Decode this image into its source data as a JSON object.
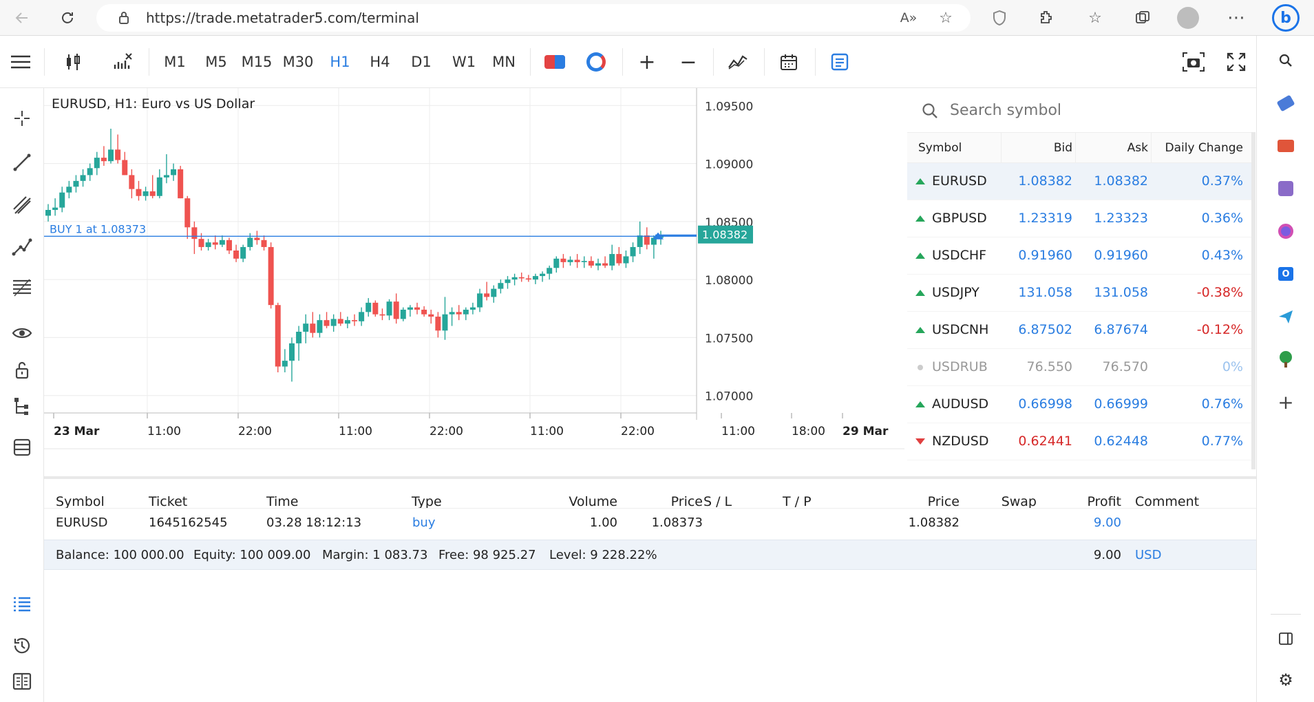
{
  "browser": {
    "url": "https://trade.metatrader5.com/terminal",
    "icons": [
      "back-icon",
      "refresh-icon",
      "lock-icon",
      "read-aloud-icon",
      "add-favorite-icon",
      "shield-icon",
      "extensions-icon",
      "favorites-icon",
      "collections-icon",
      "profile-icon",
      "more-icon",
      "bing-icon"
    ]
  },
  "edge_sidebar": {
    "icons": [
      "search-icon",
      "tag-icon",
      "toolbox-icon",
      "games-icon",
      "office-icon",
      "outlook-icon",
      "send-icon",
      "tree-icon",
      "add-icon",
      "sidebar-toggle-icon",
      "settings-icon"
    ]
  },
  "toolbar": {
    "timeframes": [
      "M1",
      "M5",
      "M15",
      "M30",
      "H1",
      "H4",
      "D1",
      "W1",
      "MN"
    ],
    "active_timeframe": "H1",
    "zoom_in": "+",
    "zoom_out": "−"
  },
  "chart": {
    "title": "EURUSD, H1: Euro vs US Dollar",
    "buy_label": "BUY 1 at 1.08373",
    "current_price_label": "1.08382",
    "accent": "#26a69a",
    "down_color": "#ef5350",
    "line_color": "#2a7de1"
  },
  "chart_data": {
    "type": "candlestick",
    "ylim": [
      1.0685,
      1.0965
    ],
    "y_ticks": [
      "1.09500",
      "1.09000",
      "1.08500",
      "1.08000",
      "1.07500",
      "1.07000"
    ],
    "y_tick_values": [
      1.095,
      1.09,
      1.085,
      1.08,
      1.075,
      1.07
    ],
    "x_tick_labels": [
      "23 Mar",
      "11:00",
      "22:00",
      "11:00",
      "22:00",
      "11:00",
      "22:00",
      "11:00",
      "18:00",
      "29 Mar"
    ],
    "buy_price": 1.08373,
    "current_price": 1.08382,
    "candles": [
      [
        1.0855,
        1.0865,
        1.085,
        1.086
      ],
      [
        1.086,
        1.087,
        1.0855,
        1.0862
      ],
      [
        1.0862,
        1.088,
        1.0858,
        1.0875
      ],
      [
        1.0875,
        1.0885,
        1.087,
        1.088
      ],
      [
        1.088,
        1.089,
        1.0875,
        1.0885
      ],
      [
        1.0885,
        1.0895,
        1.088,
        1.089
      ],
      [
        1.089,
        1.09,
        1.0885,
        1.0896
      ],
      [
        1.0896,
        1.091,
        1.089,
        1.0905
      ],
      [
        1.0905,
        1.0915,
        1.0898,
        1.0902
      ],
      [
        1.0902,
        1.093,
        1.09,
        1.0912
      ],
      [
        1.0912,
        1.0925,
        1.09,
        1.0903
      ],
      [
        1.0903,
        1.091,
        1.089,
        1.089
      ],
      [
        1.089,
        1.0895,
        1.087,
        1.0878
      ],
      [
        1.0878,
        1.0885,
        1.0868,
        1.0872
      ],
      [
        1.0872,
        1.088,
        1.0868,
        1.0876
      ],
      [
        1.0876,
        1.089,
        1.087,
        1.0872
      ],
      [
        1.0872,
        1.0895,
        1.087,
        1.0888
      ],
      [
        1.0888,
        1.0908,
        1.0883,
        1.089
      ],
      [
        1.089,
        1.09,
        1.0885,
        1.0895
      ],
      [
        1.0895,
        1.0898,
        1.087,
        1.087
      ],
      [
        1.087,
        1.0872,
        1.0835,
        1.0845
      ],
      [
        1.0845,
        1.085,
        1.0822,
        1.0835
      ],
      [
        1.0835,
        1.084,
        1.0825,
        1.0828
      ],
      [
        1.0828,
        1.0835,
        1.0825,
        1.0832
      ],
      [
        1.0832,
        1.0838,
        1.0826,
        1.083
      ],
      [
        1.083,
        1.0838,
        1.0828,
        1.0834
      ],
      [
        1.0834,
        1.0836,
        1.0822,
        1.0825
      ],
      [
        1.0825,
        1.083,
        1.0815,
        1.0818
      ],
      [
        1.0818,
        1.083,
        1.0815,
        1.0828
      ],
      [
        1.0828,
        1.084,
        1.0825,
        1.0836
      ],
      [
        1.0836,
        1.0842,
        1.083,
        1.0834
      ],
      [
        1.0834,
        1.0838,
        1.0825,
        1.0828
      ],
      [
        1.0828,
        1.0832,
        1.0775,
        1.0778
      ],
      [
        1.0778,
        1.078,
        1.072,
        1.0725
      ],
      [
        1.0725,
        1.074,
        1.072,
        1.073
      ],
      [
        1.073,
        1.075,
        1.0712,
        1.0745
      ],
      [
        1.0745,
        1.076,
        1.073,
        1.0755
      ],
      [
        1.0755,
        1.077,
        1.0745,
        1.0762
      ],
      [
        1.0762,
        1.0772,
        1.075,
        1.0754
      ],
      [
        1.0754,
        1.077,
        1.075,
        1.0765
      ],
      [
        1.0765,
        1.0772,
        1.0758,
        1.076
      ],
      [
        1.076,
        1.077,
        1.0755,
        1.0766
      ],
      [
        1.0766,
        1.0772,
        1.076,
        1.0762
      ],
      [
        1.0762,
        1.0768,
        1.0758,
        1.0765
      ],
      [
        1.0765,
        1.077,
        1.076,
        1.0764
      ],
      [
        1.0764,
        1.0776,
        1.076,
        1.0772
      ],
      [
        1.0772,
        1.0784,
        1.0768,
        1.078
      ],
      [
        1.078,
        1.0782,
        1.0768,
        1.077
      ],
      [
        1.077,
        1.0775,
        1.0765,
        1.0769
      ],
      [
        1.0769,
        1.0783,
        1.0765,
        1.0781
      ],
      [
        1.0781,
        1.0788,
        1.0762,
        1.0766
      ],
      [
        1.0766,
        1.0776,
        1.0764,
        1.0774
      ],
      [
        1.0774,
        1.0778,
        1.0768,
        1.0776
      ],
      [
        1.0776,
        1.078,
        1.077,
        1.0774
      ],
      [
        1.0774,
        1.0777,
        1.0768,
        1.077
      ],
      [
        1.077,
        1.0774,
        1.0762,
        1.0768
      ],
      [
        1.0768,
        1.0772,
        1.075,
        1.0756
      ],
      [
        1.0756,
        1.0785,
        1.0748,
        1.077
      ],
      [
        1.077,
        1.0776,
        1.076,
        1.0772
      ],
      [
        1.0772,
        1.0778,
        1.0765,
        1.077
      ],
      [
        1.077,
        1.0776,
        1.0765,
        1.0774
      ],
      [
        1.0774,
        1.078,
        1.077,
        1.0776
      ],
      [
        1.0776,
        1.0792,
        1.0772,
        1.0788
      ],
      [
        1.0788,
        1.0798,
        1.0782,
        1.0785
      ],
      [
        1.0785,
        1.0795,
        1.078,
        1.0792
      ],
      [
        1.0792,
        1.08,
        1.0788,
        1.0797
      ],
      [
        1.0797,
        1.0803,
        1.0792,
        1.08
      ],
      [
        1.08,
        1.0805,
        1.0795,
        1.0802
      ],
      [
        1.0802,
        1.0806,
        1.0798,
        1.0801
      ],
      [
        1.0801,
        1.0804,
        1.0798,
        1.08
      ],
      [
        1.08,
        1.0805,
        1.0796,
        1.0803
      ],
      [
        1.0803,
        1.0807,
        1.0798,
        1.0805
      ],
      [
        1.0805,
        1.0812,
        1.08,
        1.081
      ],
      [
        1.081,
        1.082,
        1.0806,
        1.0818
      ],
      [
        1.0818,
        1.0822,
        1.081,
        1.0815
      ],
      [
        1.0815,
        1.082,
        1.0812,
        1.0817
      ],
      [
        1.0817,
        1.0822,
        1.081,
        1.0815
      ],
      [
        1.0815,
        1.082,
        1.081,
        1.0816
      ],
      [
        1.0816,
        1.082,
        1.081,
        1.0812
      ],
      [
        1.0812,
        1.0818,
        1.0808,
        1.0814
      ],
      [
        1.0814,
        1.082,
        1.081,
        1.0812
      ],
      [
        1.0812,
        1.083,
        1.0808,
        1.0822
      ],
      [
        1.0822,
        1.0828,
        1.0812,
        1.0814
      ],
      [
        1.0814,
        1.0825,
        1.081,
        1.082
      ],
      [
        1.082,
        1.0832,
        1.0815,
        1.0828
      ],
      [
        1.0828,
        1.085,
        1.0822,
        1.0838
      ],
      [
        1.0838,
        1.0845,
        1.0826,
        1.083
      ],
      [
        1.083,
        1.0838,
        1.0818,
        1.0836
      ],
      [
        1.0836,
        1.0842,
        1.083,
        1.0838
      ]
    ]
  },
  "market_watch": {
    "search_placeholder": "Search symbol",
    "headers": {
      "symbol": "Symbol",
      "bid": "Bid",
      "ask": "Ask",
      "change": "Daily Change"
    },
    "rows": [
      {
        "symbol": "EURUSD",
        "bid": "1.08382",
        "ask": "1.08382",
        "change": "0.37%",
        "dir": "up"
      },
      {
        "symbol": "GBPUSD",
        "bid": "1.23319",
        "ask": "1.23323",
        "change": "0.36%",
        "dir": "up"
      },
      {
        "symbol": "USDCHF",
        "bid": "0.91960",
        "ask": "0.91960",
        "change": "0.43%",
        "dir": "up"
      },
      {
        "symbol": "USDJPY",
        "bid": "131.058",
        "ask": "131.058",
        "change": "-0.38%",
        "dir": "up"
      },
      {
        "symbol": "USDCNH",
        "bid": "6.87502",
        "ask": "6.87674",
        "change": "-0.12%",
        "dir": "up"
      },
      {
        "symbol": "USDRUB",
        "bid": "76.550",
        "ask": "76.570",
        "change": "0%",
        "dir": "flat"
      },
      {
        "symbol": "AUDUSD",
        "bid": "0.66998",
        "ask": "0.66999",
        "change": "0.76%",
        "dir": "up"
      },
      {
        "symbol": "NZDUSD",
        "bid": "0.62441",
        "ask": "0.62448",
        "change": "0.77%",
        "dir": "down"
      }
    ]
  },
  "trade": {
    "headers": {
      "symbol": "Symbol",
      "ticket": "Ticket",
      "time": "Time",
      "type": "Type",
      "volume": "Volume",
      "price": "Price",
      "sl": "S / L",
      "tp": "T / P",
      "price2": "Price",
      "swap": "Swap",
      "profit": "Profit",
      "comment": "Comment"
    },
    "row": {
      "symbol": "EURUSD",
      "ticket": "1645162545",
      "time": "03.28 18:12:13",
      "type": "buy",
      "volume": "1.00",
      "price": "1.08373",
      "price2": "1.08382",
      "profit": "9.00"
    },
    "summary": {
      "balance": "Balance: 100 000.00",
      "equity": "Equity: 100 009.00",
      "margin": "Margin: 1 083.73",
      "free": "Free: 98 925.27",
      "level": "Level: 9 228.22%",
      "profit": "9.00",
      "currency": "USD"
    }
  }
}
